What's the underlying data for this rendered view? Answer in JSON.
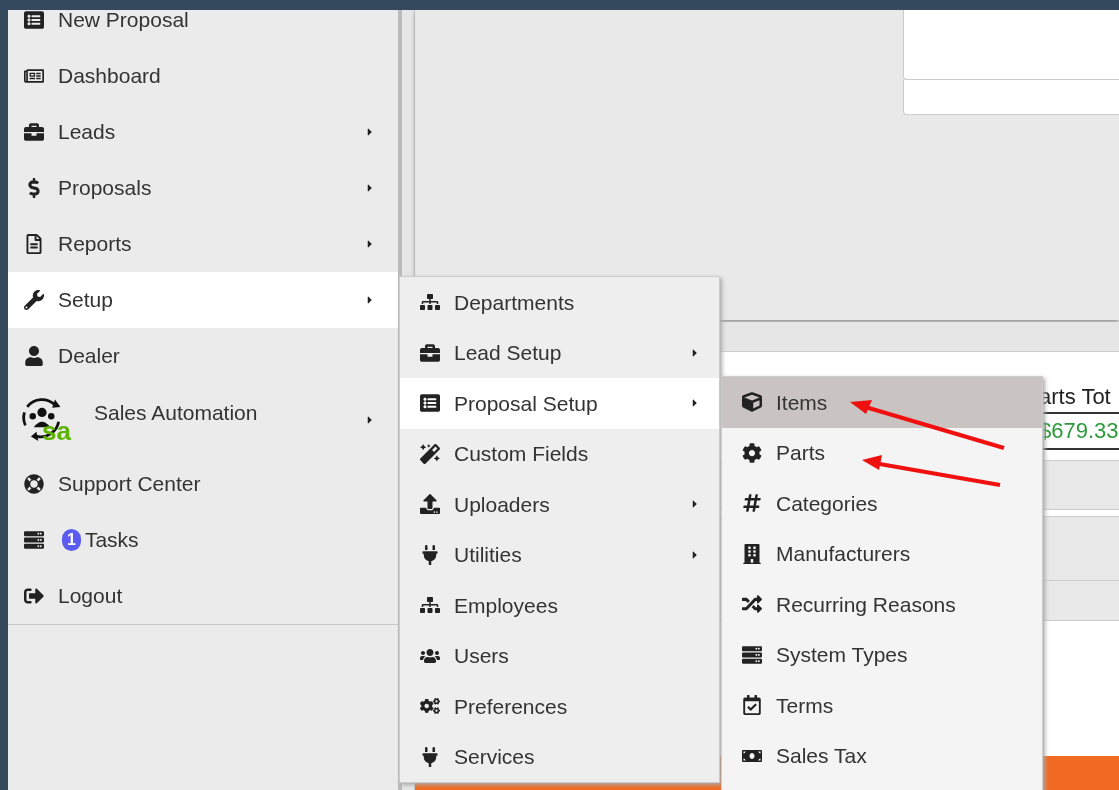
{
  "sidebar": {
    "items": [
      {
        "label": "New Proposal",
        "has_submenu": false,
        "selected": false
      },
      {
        "label": "Dashboard",
        "has_submenu": false,
        "selected": false
      },
      {
        "label": "Leads",
        "has_submenu": true,
        "selected": false
      },
      {
        "label": "Proposals",
        "has_submenu": true,
        "selected": false
      },
      {
        "label": "Reports",
        "has_submenu": true,
        "selected": false
      },
      {
        "label": "Setup",
        "has_submenu": true,
        "selected": true
      },
      {
        "label": "Dealer",
        "has_submenu": false,
        "selected": false
      },
      {
        "label": "Sales Automation",
        "has_submenu": true,
        "selected": false,
        "kind": "logo",
        "logo_text": "sa"
      },
      {
        "label": "Support Center",
        "has_submenu": false,
        "selected": false
      },
      {
        "label": "Tasks",
        "has_submenu": false,
        "selected": false,
        "badge": "1"
      },
      {
        "label": "Logout",
        "has_submenu": false,
        "selected": false
      }
    ]
  },
  "setup_menu": {
    "items": [
      {
        "label": "Departments",
        "has_submenu": false,
        "selected": false
      },
      {
        "label": "Lead Setup",
        "has_submenu": true,
        "selected": false
      },
      {
        "label": "Proposal Setup",
        "has_submenu": true,
        "selected": true
      },
      {
        "label": "Custom Fields",
        "has_submenu": false,
        "selected": false
      },
      {
        "label": "Uploaders",
        "has_submenu": true,
        "selected": false
      },
      {
        "label": "Utilities",
        "has_submenu": true,
        "selected": false
      },
      {
        "label": "Employees",
        "has_submenu": false,
        "selected": false
      },
      {
        "label": "Users",
        "has_submenu": false,
        "selected": false
      },
      {
        "label": "Preferences",
        "has_submenu": false,
        "selected": false
      },
      {
        "label": "Services",
        "has_submenu": false,
        "selected": false
      }
    ]
  },
  "proposal_setup_menu": {
    "items": [
      {
        "label": "Items",
        "selected": true
      },
      {
        "label": "Parts",
        "selected": false
      },
      {
        "label": "Categories",
        "selected": false
      },
      {
        "label": "Manufacturers",
        "selected": false
      },
      {
        "label": "Recurring Reasons",
        "selected": false
      },
      {
        "label": "System Types",
        "selected": false
      },
      {
        "label": "Terms",
        "selected": false
      },
      {
        "label": "Sales Tax",
        "selected": false
      }
    ]
  },
  "background": {
    "column_header": "arts Tot",
    "total": "$679.33"
  }
}
